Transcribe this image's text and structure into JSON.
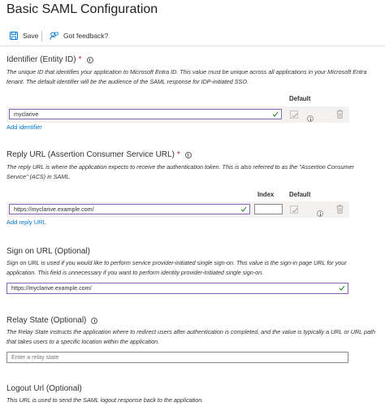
{
  "page": {
    "title": "Basic SAML Configuration"
  },
  "toolbar": {
    "save_label": "Save",
    "feedback_label": "Got feedback?"
  },
  "columns": {
    "default_label": "Default",
    "index_label": "Index"
  },
  "identifier": {
    "title": "Identifier (Entity ID)",
    "required_mark": "*",
    "description": "The unique ID that identifies your application to Microsoft Entra ID. This value must be unique across all applications in your Microsoft Entra tenant. The default identifier will be the audience of the SAML response for IDP-initiated SSO.",
    "value": "myclarive",
    "add_link": "Add identifier"
  },
  "reply_url": {
    "title": "Reply URL (Assertion Consumer Service URL)",
    "required_mark": "*",
    "description": "The reply URL is where the application expects to receive the authentication token. This is also referred to as the \"Assertion Consumer Service\" (ACS) in SAML.",
    "value": "https://myclarive.example.com/",
    "index_value": "",
    "add_link": "Add reply URL"
  },
  "sign_on_url": {
    "title": "Sign on URL (Optional)",
    "description": "Sign on URL is used if you would like to perform service provider-initiated single sign-on. This value is the sign-in page URL for your application. This field is unnecessary if you want to perform identity provider-initiated single sign-on.",
    "value": "https://myclarive.example.com/"
  },
  "relay_state": {
    "title": "Relay State (Optional)",
    "description": "The Relay State instructs the application where to redirect users after authentication is completed, and the value is typically a URL or URL path that takes users to a specific location within the application.",
    "placeholder": "Enter a relay state"
  },
  "logout_url": {
    "title": "Logout Url (Optional)",
    "description": "This URL is used to send the SAML logout response back to the application."
  },
  "colors": {
    "accent": "#8764b8",
    "valid_check": "#107c10",
    "link": "#0078d4",
    "required": "#a4262c"
  }
}
